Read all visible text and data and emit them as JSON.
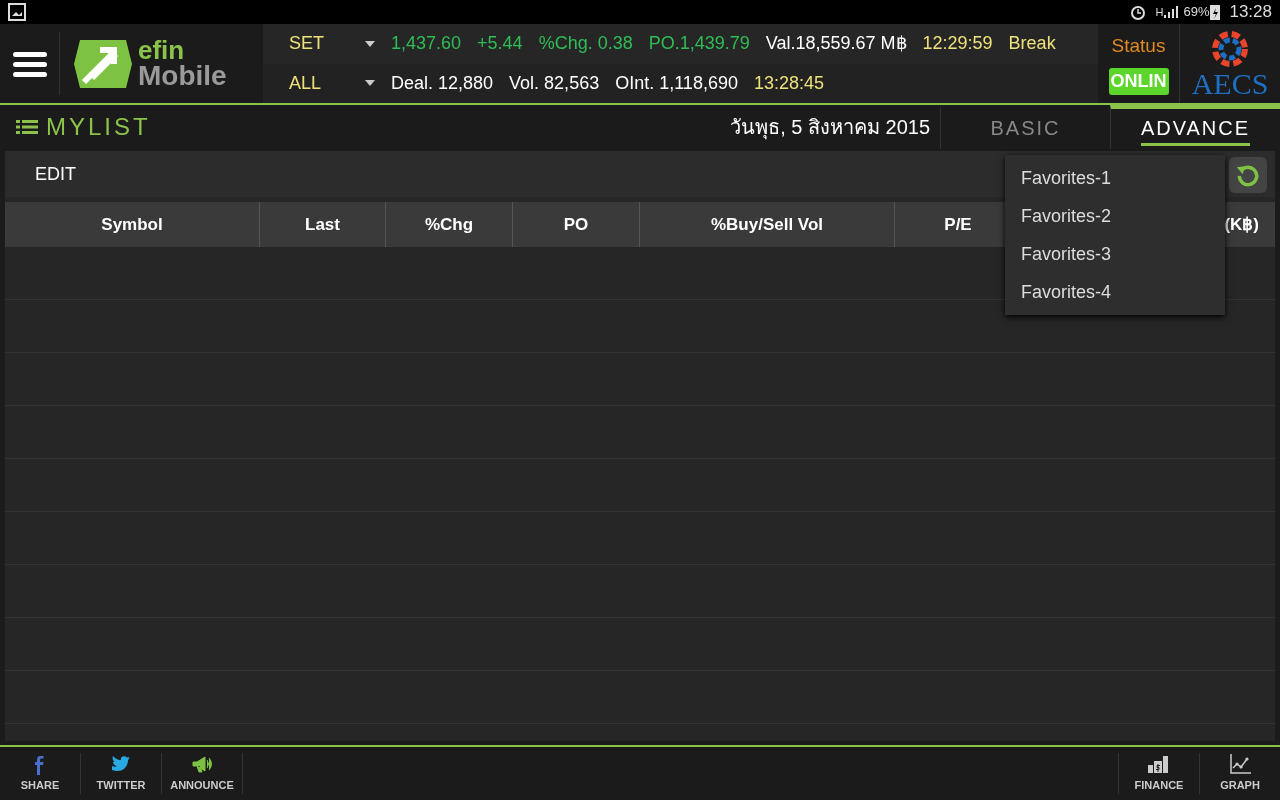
{
  "status_bar": {
    "network": "H",
    "battery": "69%",
    "time": "13:28"
  },
  "header": {
    "logo_top": "efin",
    "logo_bottom": "Mobile",
    "ticker_rows": [
      {
        "market": "SET",
        "items": [
          {
            "text": "1,437.60",
            "kind": "up"
          },
          {
            "text": "+5.44",
            "kind": "up"
          },
          {
            "text": "%Chg. 0.38",
            "kind": "up"
          },
          {
            "text": "PO.1,439.79",
            "kind": "up"
          },
          {
            "text": "Val.18,559.67 M฿",
            "kind": "plain"
          },
          {
            "text": "12:29:59",
            "kind": "time"
          },
          {
            "text": "Break",
            "kind": "time"
          }
        ]
      },
      {
        "market": "ALL",
        "items": [
          {
            "text": "Deal. 12,880",
            "kind": "plain"
          },
          {
            "text": "Vol. 82,563",
            "kind": "plain"
          },
          {
            "text": "OInt. 1,118,690",
            "kind": "plain"
          },
          {
            "text": "13:28:45",
            "kind": "time"
          }
        ]
      }
    ],
    "status_label": "Status",
    "status_value": "ONLIN",
    "broker_logo": "AECS"
  },
  "title_bar": {
    "title": "MYLIST",
    "date": "วันพุธ, 5 สิงหาคม 2015",
    "tabs": [
      {
        "label": "BASIC",
        "selected": false
      },
      {
        "label": "ADVANCE",
        "selected": true
      }
    ]
  },
  "toolbar": {
    "edit": "EDIT"
  },
  "table": {
    "columns": [
      "Symbol",
      "Last",
      "%Chg",
      "PO",
      "%Buy/Sell Vol",
      "P/E",
      "(K฿)"
    ]
  },
  "dropdown": {
    "items": [
      "Favorites-1",
      "Favorites-2",
      "Favorites-3",
      "Favorites-4"
    ]
  },
  "bottom_bar": {
    "left": [
      {
        "label": "SHARE",
        "kind": "facebook"
      },
      {
        "label": "TWITTER",
        "kind": "twitter"
      },
      {
        "label": "ANNOUNCE",
        "kind": "announce"
      }
    ],
    "right": [
      {
        "label": "FINANCE",
        "kind": "finance"
      },
      {
        "label": "GRAPH",
        "kind": "graph"
      }
    ]
  }
}
